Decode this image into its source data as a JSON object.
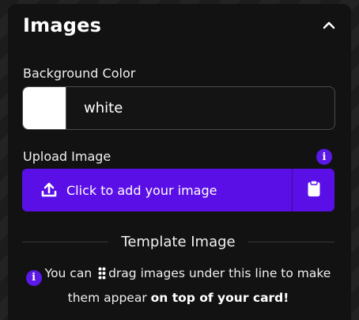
{
  "section": {
    "title": "Images",
    "collapse_icon": "chevron-up-icon"
  },
  "background": {
    "label": "Background Color",
    "swatch_color": "#ffffff",
    "value": "white"
  },
  "upload": {
    "label": "Upload Image",
    "info_icon": "info-icon",
    "button_label": "Click to add your image",
    "button_icon": "upload-icon",
    "paste_icon": "clipboard-icon",
    "accent": "#5a0fe6"
  },
  "template": {
    "divider_label": "Template Image",
    "note_prefix": "You can",
    "note_middle": "drag images under this line to make them appear",
    "note_emphasis": "on top of your card!",
    "grip_icon": "grip-dots-icon"
  }
}
